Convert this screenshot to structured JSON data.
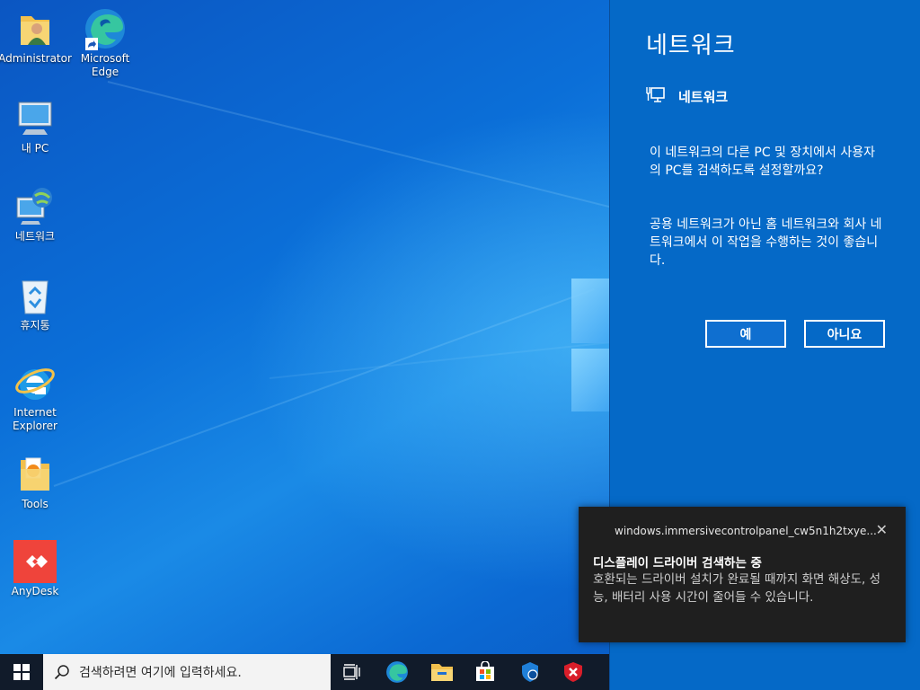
{
  "desktop_icons": [
    {
      "label": "Administrator",
      "icon": "user-folder-icon"
    },
    {
      "label": "Microsoft Edge",
      "icon": "edge-icon"
    },
    {
      "label": "내 PC",
      "icon": "computer-icon"
    },
    {
      "label": "네트워크",
      "icon": "network-icon"
    },
    {
      "label": "휴지통",
      "icon": "recycle-bin-icon"
    },
    {
      "label": "Internet Explorer",
      "icon": "internet-explorer-icon"
    },
    {
      "label": "Tools",
      "icon": "tools-folder-icon"
    },
    {
      "label": "AnyDesk",
      "icon": "anydesk-icon"
    }
  ],
  "flyout": {
    "title": "네트워크",
    "network_label": "네트워크",
    "question": "이 네트워크의 다른 PC 및 장치에서 사용자의 PC를 검색하도록 설정할까요?",
    "advice": "공용 네트워크가 아닌 홈 네트워크와 회사 네트워크에서 이 작업을 수행하는 것이 좋습니다.",
    "yes_label": "예",
    "no_label": "아니요",
    "background_color": "#0569c7"
  },
  "toast": {
    "app_name": "windows.immersivecontrolpanel_cw5n1h2txye...",
    "close_glyph": "✕",
    "title": "디스플레이 드라이버 검색하는 중",
    "body": "호환되는 드라이버 설치가 완료될 때까지 화면 해상도, 성능, 배터리 사용 시간이 줄어들 수 있습니다."
  },
  "taskbar": {
    "search_placeholder": "검색하려면 여기에 입력하세요.",
    "pinned_icons": [
      "task-view-icon",
      "edge-icon",
      "file-explorer-icon",
      "microsoft-store-icon",
      "security-shield-icon",
      "antivirus-icon"
    ]
  }
}
